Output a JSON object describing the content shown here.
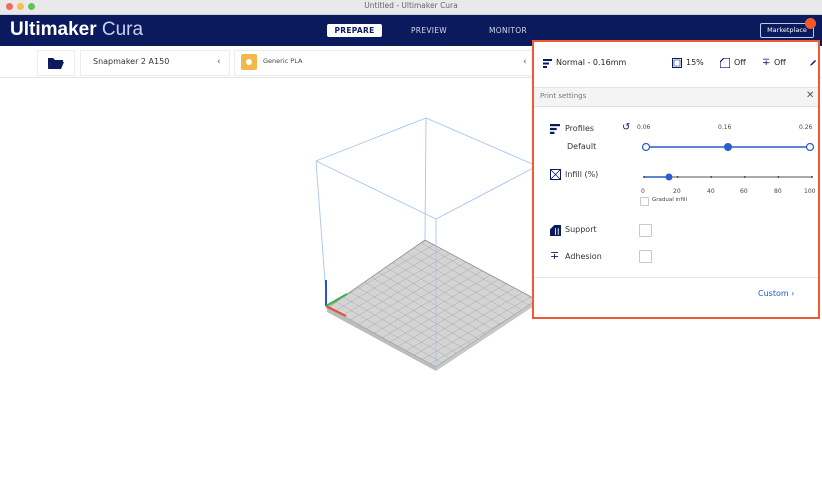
{
  "window": {
    "title": "Untitled - Ultimaker Cura"
  },
  "brand": {
    "bold": "Ultimaker",
    "thin": "Cura"
  },
  "stages": [
    {
      "label": "PREPARE",
      "active": true
    },
    {
      "label": "PREVIEW",
      "active": false
    },
    {
      "label": "MONITOR",
      "active": false
    }
  ],
  "marketplace": {
    "label": "Marketplace"
  },
  "toolbar": {
    "printer": "Snapmaker 2 A150",
    "material": "Generic PLA"
  },
  "summary": {
    "profile": "Normal - 0.16mm",
    "infill": "15%",
    "support": "Off",
    "adhesion": "Off"
  },
  "print_settings": {
    "title": "Print settings",
    "profiles": {
      "label": "Profiles",
      "sublabel": "Default",
      "ticks": [
        "0.06",
        "0.16",
        "0.26"
      ],
      "selected_value": "0.16"
    },
    "infill": {
      "label": "Infill (%)",
      "ticks": [
        "0",
        "20",
        "40",
        "60",
        "80",
        "100"
      ],
      "value_percent": 15,
      "gradual_label": "Gradual infill"
    },
    "support": {
      "label": "Support",
      "checked": false
    },
    "adhesion": {
      "label": "Adhesion",
      "checked": false
    },
    "custom": {
      "label": "Custom"
    }
  },
  "colors": {
    "header_bg": "#0a1a5c",
    "accent": "#ef5a2e",
    "slider": "#2a5ec8"
  }
}
